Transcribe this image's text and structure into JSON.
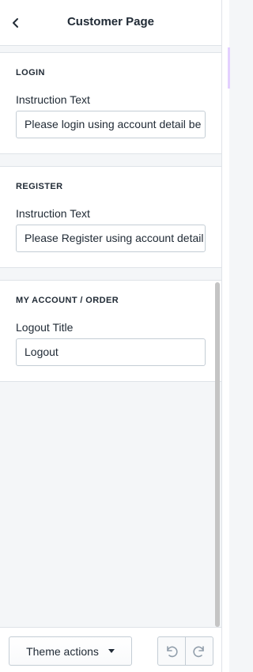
{
  "header": {
    "title": "Customer Page",
    "back_icon": "chevron-left-icon"
  },
  "sections": [
    {
      "title": "LOGIN",
      "field_label": "Instruction Text",
      "field_value": "Please login using account detail be"
    },
    {
      "title": "REGISTER",
      "field_label": "Instruction Text",
      "field_value": "Please Register using account detail"
    },
    {
      "title": "MY ACCOUNT / ORDER",
      "field_label": "Logout Title",
      "field_value": "Logout"
    }
  ],
  "footer": {
    "theme_actions_label": "Theme actions",
    "undo_icon": "undo-icon",
    "redo_icon": "redo-icon"
  },
  "colors": {
    "text": "#212b36",
    "border": "#c4cdd5",
    "background": "#f4f6f8"
  }
}
